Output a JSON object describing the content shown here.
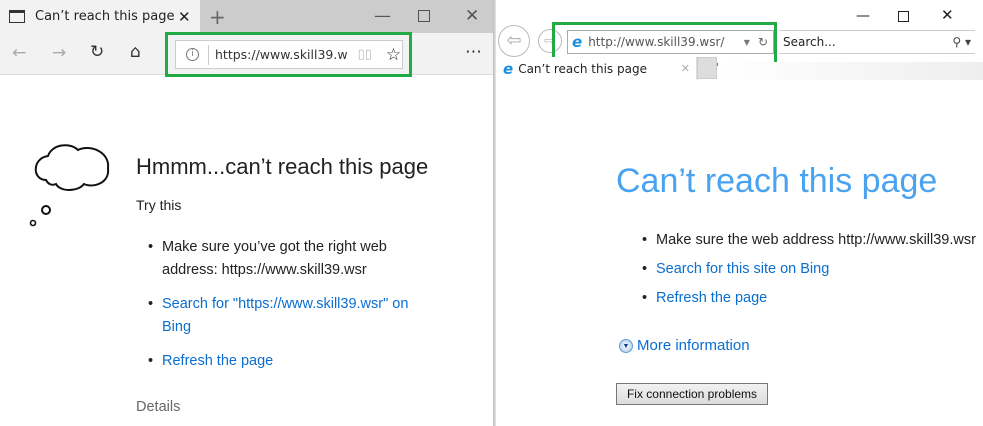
{
  "edge": {
    "tab_title": "Can’t reach this page",
    "address": "https://www.skill39.w",
    "heading": "Hmmm...can’t reach this page",
    "try_this": "Try this",
    "bullet1": "Make sure you’ve got the right web address: https://www.skill39.wsr",
    "bullet2": "Search for \"https://www.skill39.wsr\" on Bing",
    "bullet3": "Refresh the page",
    "details": "Details"
  },
  "ie": {
    "address": "http://www.skill39.wsr/",
    "search_placeholder": "Search...",
    "tab_title": "Can’t reach this page",
    "heading": "Can’t reach this page",
    "bullet1": "Make sure the web address http://www.skill39.wsr",
    "bullet2": "Search for this site on Bing",
    "bullet3": "Refresh the page",
    "more_info": "More information",
    "fix_button": "Fix connection problems"
  },
  "colors": {
    "highlight": "#22aa44",
    "link": "#0a6ed1",
    "ie_heading": "#4aa3f0"
  }
}
